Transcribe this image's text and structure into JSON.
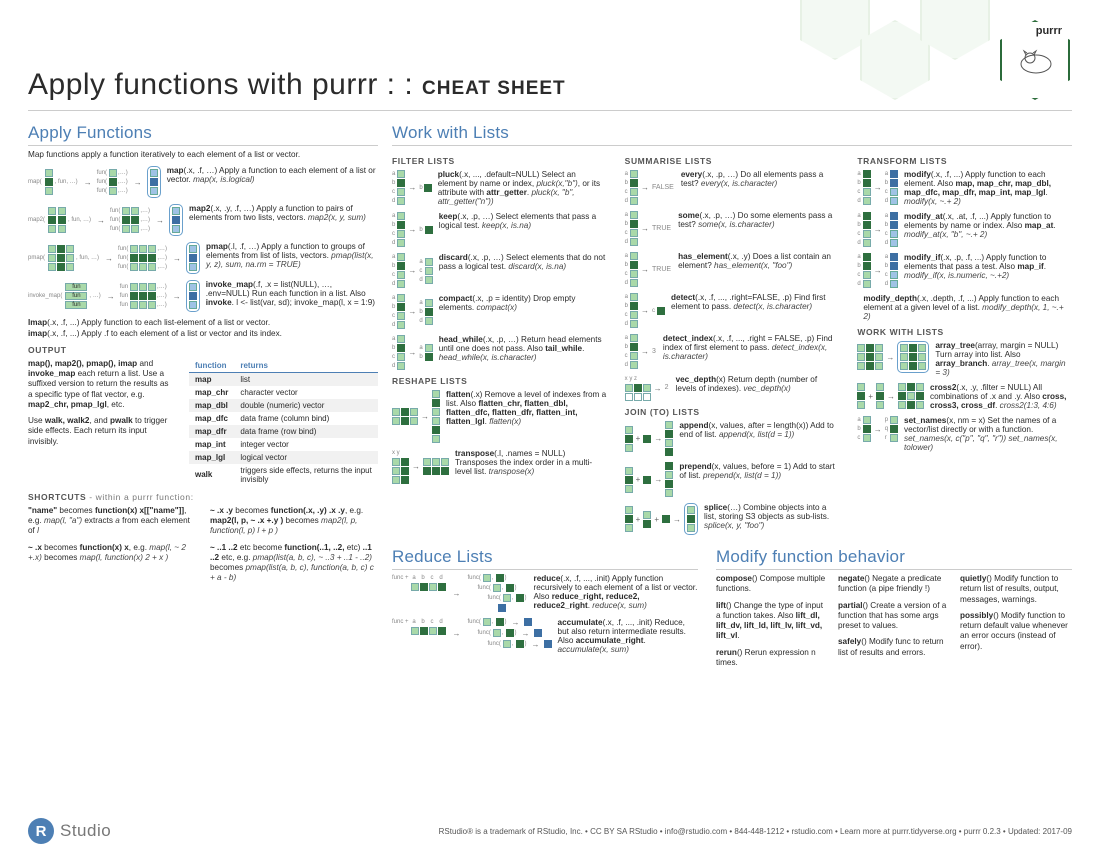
{
  "header": {
    "title": "Apply functions with purrr : :",
    "subtitle": "CHEAT SHEET",
    "logo_label": "purrr"
  },
  "apply": {
    "heading": "Apply Functions",
    "intro": "Map functions apply a function iteratively to each element of a list or vector.",
    "fns": [
      {
        "name": "map",
        "sig": "(.x, .f, …)",
        "body": " Apply a function to each element of a list or vector. ",
        "ex": "map(x, is.logical)",
        "diaglabel": "map(",
        "funlabel": "fun("
      },
      {
        "name": "map2",
        "sig": "(.x, .y, .f, …)",
        "body": " Apply a function to pairs of elements from two lists, vectors. ",
        "ex": "map2(x, y, sum)",
        "diaglabel": "map2(",
        "funlabel": "fun("
      },
      {
        "name": "pmap",
        "sig": "(.l, .f, …)",
        "body": " Apply a function to groups of elements from list of lists, vectors. ",
        "ex": "pmap(list(x, y, z), sum, na.rm = TRUE)",
        "diaglabel": "pmap(",
        "funlabel": "fun("
      },
      {
        "name": "invoke_map",
        "sig": "(.f, .x = list(NULL), …, .env=NULL)",
        "body": " Run each function in a list. Also ",
        "also": "invoke",
        "extra": ". l <- list(var, sd); invoke_map(l, x = 1:9)",
        "diaglabel": "invoke_map(",
        "funlabel": "fun"
      }
    ],
    "below": "lmap(.x, .f, ...) Apply function to each list-element of a list or vector.\nimap(.x, .f, ...) Apply .f to each element of a list or vector and its index.",
    "lmap_lead": "lmap",
    "lmap_sig": "(.x, .f, ...)",
    "lmap_body": " Apply function to each list-element of a list or vector.",
    "imap_lead": "imap",
    "imap_sig": "(.x, .f, ...)",
    "imap_body": " Apply .f to each element of a list or vector and its index.",
    "output_h": "OUTPUT",
    "output_left": "map(), map2(), pmap(), imap and invoke_map each return a list. Use a suffixed version to return the results as a specific type of flat vector, e.g. map2_chr, pmap_lgl, etc.\n\nUse walk, walk2, and pwalk to trigger side effects. Each return its input invisibly.",
    "out_left_p1a": "map(), map2(), pmap(), imap",
    "out_left_p1b": " and ",
    "out_left_p1c": "invoke_map",
    "out_left_p1d": " each return a list. Use a suffixed version to return the results as a specific type of flat vector, e.g. ",
    "out_left_p1e": "map2_chr, pmap_lgl",
    "out_left_p1f": ", etc.",
    "out_left_p2a": "Use ",
    "out_left_p2b": "walk, walk2",
    "out_left_p2c": ", and ",
    "out_left_p2d": "pwalk",
    "out_left_p2e": " to trigger side effects. Each return its input invisibly.",
    "output_cols": [
      "function",
      "returns"
    ],
    "output_rows": [
      [
        "map",
        "list"
      ],
      [
        "map_chr",
        "character vector"
      ],
      [
        "map_dbl",
        "double (numeric) vector"
      ],
      [
        "map_dfc",
        "data frame (column bind)"
      ],
      [
        "map_dfr",
        "data frame (row bind)"
      ],
      [
        "map_int",
        "integer vector"
      ],
      [
        "map_lgl",
        "logical vector"
      ],
      [
        "walk",
        "triggers side effects, returns the input invisibly"
      ]
    ],
    "shortcuts_h": "SHORTCUTS",
    "shortcuts_sub": " - within a purrr function:",
    "short": [
      {
        "a": "\"name\"",
        "b": " becomes ",
        "c": "function(x) x[[\"name\"]]",
        "d": ", e.g. ",
        "e": "map(l, \"a\")",
        "f": " extracts ",
        "g": "a",
        "h": " from each element of ",
        "i": "l"
      },
      {
        "a": "~ .x",
        "b": " becomes ",
        "c": "function(x) x",
        "d": ", e.g. ",
        "e": "map(l, ~ 2 +.x)",
        "f": " becomes ",
        "g": "map(l, function(x) 2 + x )"
      },
      {
        "a": "~ .x .y",
        "b": " becomes ",
        "c": "function(.x, .y) .x .y",
        "d": ", e.g. ",
        "e": "map2(l, p, ~ .x +.y )",
        "f": " becomes ",
        "g": "map2(l, p, function(l, p) l + p )"
      },
      {
        "a": "~ ..1 ..2",
        "b": " etc become ",
        "c": "function(..1, ..2,",
        "d": " etc) ",
        "e": "..1 ..2",
        "f": " etc, e.g. ",
        "g": "pmap(list(a, b, c), ~ ..3 + ..1 - ..2)",
        "h": " becomes ",
        "i": "pmap(list(a, b, c), function(a, b, c) c + a - b)"
      }
    ]
  },
  "lists": {
    "heading": "Work with Lists",
    "filter_h": "FILTER LISTS",
    "filter": [
      {
        "lead": "pluck",
        "sig": "(.x, ..., .default=NULL)",
        "body": " Select an element by name or index, ",
        "ex1": "pluck(x,\"b\")",
        "mid": ", or its attribute with ",
        "also": "attr_getter",
        "after": ". ",
        "ex": "pluck(x, \"b\", attr_getter(\"n\"))",
        "lbls": "abcd",
        "out": "b"
      },
      {
        "lead": "keep",
        "sig": "(.x, .p, …)",
        "body": " Select elements that pass a logical test. ",
        "ex": "keep(x, is.na)",
        "lbls": "abcd"
      },
      {
        "lead": "discard",
        "sig": "(.x, .p, …)",
        "body": " Select elements that do not pass a logical test. ",
        "ex": "discard(x, is.na)",
        "lbls": "abcd"
      },
      {
        "lead": "compact",
        "sig": "(.x, .p = identity)",
        "body": " Drop empty elements. ",
        "ex": "compact(x)",
        "lbls": "abcd"
      },
      {
        "lead": "head_while",
        "sig": "(.x, .p, …)",
        "body": " Return head elements until one does not pass. Also ",
        "also": "tail_while",
        "after": ". ",
        "ex": "head_while(x, is.character)",
        "lbls": "abcd"
      }
    ],
    "reshape_h": "RESHAPE LISTS",
    "reshape": [
      {
        "lead": "flatten",
        "sig": "(.x)",
        "body": " Remove a level of indexes from a list. Also ",
        "also": "flatten_chr, flatten_dbl, flatten_dfc, flatten_dfr, flatten_int, flatten_lgl",
        "after": ". ",
        "ex": "flatten(x)"
      },
      {
        "lead": "transpose",
        "sig": "(.l, .names = NULL)",
        "body": " Transposes the index order in a multi-level list. ",
        "ex": "transpose(x)",
        "collab": "x y"
      }
    ],
    "summarise_h": "SUMMARISE LISTS",
    "summarise": [
      {
        "lead": "every",
        "sig": "(.x, .p, …)",
        "body": " Do all elements pass a test? ",
        "ex": "every(x, is.character)",
        "res": "FALSE"
      },
      {
        "lead": "some",
        "sig": "(.x, .p, …)",
        "body": " Do some elements pass a test? ",
        "ex": "some(x, is.character)",
        "res": "TRUE"
      },
      {
        "lead": "has_element",
        "sig": "(.x, .y)",
        "body": " Does a list contain an element? ",
        "ex": "has_element(x, \"foo\")",
        "res": "TRUE"
      },
      {
        "lead": "detect",
        "sig": "(.x, .f, ..., .right=FALSE, .p)",
        "body": " Find first element to pass. ",
        "ex": "detect(x, is.character)"
      },
      {
        "lead": "detect_index",
        "sig": "(.x, .f, ..., .right = FALSE, .p)",
        "body": " Find index of first element to pass. ",
        "ex": "detect_index(x, is.character)",
        "res": "3"
      },
      {
        "lead": "vec_depth",
        "sig": "(x)",
        "body": " Return depth (number of levels of indexes). ",
        "ex": "vec_depth(x)",
        "res": "2",
        "collab": "x y z"
      }
    ],
    "join_h": "JOIN (TO) LISTS",
    "join": [
      {
        "lead": "append",
        "sig": "(x, values, after = length(x))",
        "body": " Add to end of list. ",
        "ex": "append(x, list(d = 1))"
      },
      {
        "lead": "prepend",
        "sig": "(x, values, before = 1)",
        "body": " Add to start of list. ",
        "ex": "prepend(x, list(d = 1))"
      },
      {
        "lead": "splice",
        "sig": "(…)",
        "body": " Combine objects into a list, storing S3 objects as sub-lists. ",
        "ex": "splice(x, y, \"foo\")"
      }
    ],
    "transform_h": "TRANSFORM LISTS",
    "transform": [
      {
        "lead": "modify",
        "sig": "(.x, .f, ...)",
        "body": " Apply function to each element. Also ",
        "also": "map, map_chr, map_dbl, map_dfc, map_dfr, map_int, map_lgl",
        "after": ". ",
        "ex": "modify(x, ~.+ 2)",
        "diag": true,
        "lbls": "abcd"
      },
      {
        "lead": "modify_at",
        "sig": "(.x, .at, .f, ...)",
        "body": " Apply function to elements by name or index. Also ",
        "also": "map_at",
        "after": ". ",
        "ex": "modify_at(x, \"b\", ~.+ 2)",
        "diag": true,
        "lbls": "abcd"
      },
      {
        "lead": "modify_if",
        "sig": "(.x, .p, .f, ...)",
        "body": " Apply function to elements that pass a test. Also ",
        "also": "map_if",
        "after": ". ",
        "ex": "modify_if(x, is.numeric, ~.+2)",
        "diag": true,
        "lbls": "abcd"
      },
      {
        "lead": "modify_depth",
        "sig": "(.x, .depth, .f, ...)",
        "body": " Apply function to each element at a given level of a list. ",
        "ex": "modify_depth(x, 1, ~.+ 2)"
      }
    ],
    "work_h": "WORK WITH LISTS",
    "work": [
      {
        "lead": "array_tree",
        "sig": "(array, margin = NULL)",
        "body": " Turn array into list. Also ",
        "also": "array_branch",
        "after": ". ",
        "ex": "array_tree(x, margin = 3)",
        "diag": true
      },
      {
        "lead": "cross2",
        "sig": "(.x, .y, .filter = NULL)",
        "body": " All combinations of .x and .y. Also ",
        "also": "cross, cross3, cross_df",
        "after": ". ",
        "ex": "cross2(1:3, 4:6)",
        "diag": true
      },
      {
        "lead": "set_names",
        "sig": "(x, nm = x)",
        "body": " Set the names of a vector/list directly or with a function. ",
        "ex": "set_names(x, c(\"p\", \"q\", \"r\")) set_names(x, tolower)",
        "diag": true,
        "lbls_l": "abc",
        "lbls_r": "pqr"
      }
    ]
  },
  "reduce": {
    "heading": "Reduce Lists",
    "items": [
      {
        "lead": "reduce",
        "sig": "(.x, .f, ..., .init)",
        "body": " Apply function recursively to each element of a list or vector. Also ",
        "also": "reduce_right, reduce2, reduce2_right",
        "after": ". ",
        "ex": "reduce(x, sum)"
      },
      {
        "lead": "accumulate",
        "sig": "(.x, .f, ..., .init)",
        "body": " Reduce, but also return intermediate results. Also ",
        "also": "accumulate_right",
        "after": ". ",
        "ex": "accumulate(x, sum)"
      }
    ],
    "funclabel": "func +",
    "funclabel2": "func(",
    "flabels": "a b c d"
  },
  "modify": {
    "heading": "Modify function behavior",
    "items": [
      {
        "lead": "compose",
        "sig": "()",
        "body": " Compose multiple functions."
      },
      {
        "lead": "lift",
        "sig": "()",
        "body": " Change the type of input a function takes. Also ",
        "also": "lift_dl, lift_dv, lift_ld, lift_lv, lift_vd, lift_vl",
        "after": "."
      },
      {
        "lead": "rerun",
        "sig": "()",
        "body": " Rerun expression n times."
      },
      {
        "lead": "negate",
        "sig": "()",
        "body": " Negate a predicate function (a pipe friendly !)"
      },
      {
        "lead": "partial",
        "sig": "()",
        "body": " Create a version of a function that has some args preset to values."
      },
      {
        "lead": "safely",
        "sig": "()",
        "body": " Modify func to return list of results and errors."
      },
      {
        "lead": "quietly",
        "sig": "()",
        "body": " Modify function to return list of results, output, messages, warnings."
      },
      {
        "lead": "possibly",
        "sig": "()",
        "body": " Modify function to return default value whenever an error occurs (instead of error)."
      }
    ]
  },
  "footer": {
    "brand": "Studio",
    "text": "RStudio® is a trademark of RStudio, Inc.  •  CC BY SA  RStudio  •  info@rstudio.com  •  844-448-1212  •  rstudio.com  •  Learn more at purrr.tidyverse.org  •  purrr  0.2.3  •  Updated: 2017-09"
  },
  "glyphs": {
    "arrow": "→",
    "plus": "+",
    "paren_open": "(",
    "paren_close": ")",
    "comma": ", "
  }
}
